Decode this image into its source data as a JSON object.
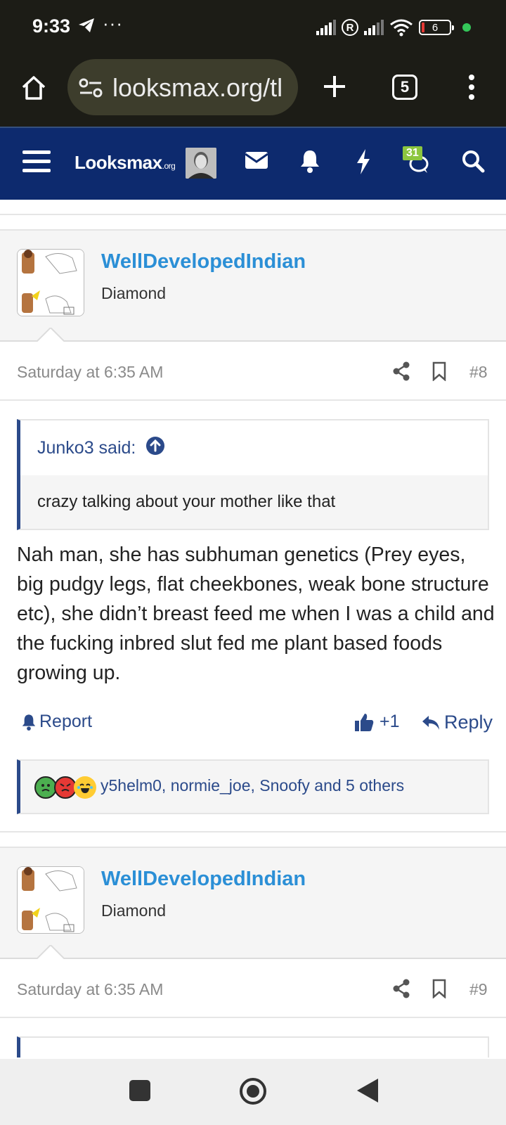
{
  "status_bar": {
    "time": "9:33",
    "more": "···",
    "battery": "6"
  },
  "browser": {
    "url": "looksmax.org/tl",
    "tab_count": "5"
  },
  "site_header": {
    "logo_main": "Looksmax",
    "logo_suffix": ".org",
    "chat_badge": "31"
  },
  "posts": [
    {
      "username": "WellDevelopedIndian",
      "rank": "Diamond",
      "date": "Saturday at 6:35 AM",
      "post_number": "#8",
      "quote_author": "Junko3 said:",
      "quote_text": "crazy talking about your mother like that",
      "body": "Nah man, she has subhuman genetics (Prey eyes, big pudgy legs, flat cheekbones, weak bone structure etc), she didn’t breast feed me when I was a child and the fucking inbred slut fed me plant based foods growing up.",
      "report_label": "Report",
      "like_count": "+1",
      "reply_label": "Reply",
      "reactions_text": "y5helm0, normie_joe, Snoofy and 5 others"
    },
    {
      "username": "WellDevelopedIndian",
      "rank": "Diamond",
      "date": "Saturday at 6:35 AM",
      "post_number": "#9"
    }
  ],
  "colors": {
    "header_bg": "#0d2a6e",
    "username": "#2b8fd6",
    "link": "#2b4a8a",
    "browser_bg": "#1c1c16"
  }
}
